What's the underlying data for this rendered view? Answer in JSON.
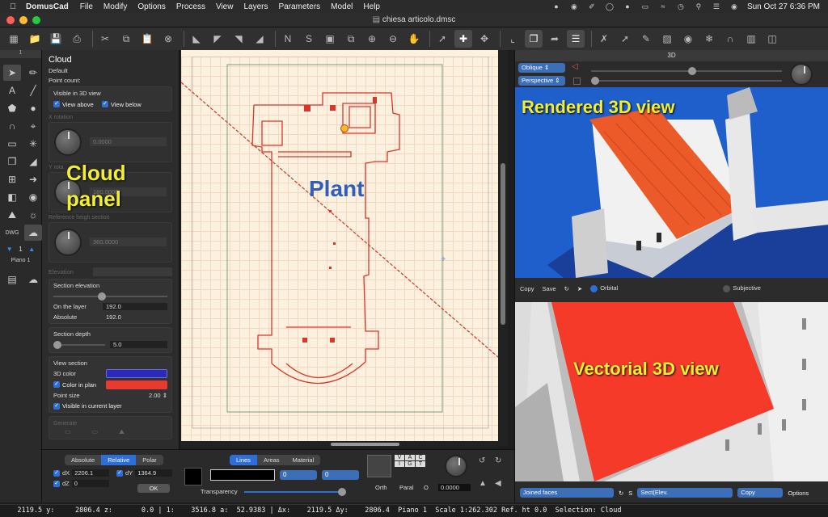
{
  "menubar": {
    "app_name": "DomusCad",
    "items": [
      "File",
      "Modify",
      "Options",
      "Process",
      "View",
      "Layers",
      "Parameters",
      "Model",
      "Help"
    ],
    "clock": "Sun Oct 27  6:36 PM"
  },
  "window": {
    "title": "chiesa articolo.dmsc"
  },
  "palette": {
    "tab": "1",
    "dwg_label": "DWG",
    "layer_number": "1",
    "layer_name": "Piano 1"
  },
  "cloud_panel": {
    "title": "Cloud",
    "subtitle": "Default",
    "point_count_label": "Point count:",
    "visible_3d_label": "Visible in 3D view",
    "view_above": "View above",
    "view_below": "View below",
    "x_rotation_label": "X rotation",
    "x_rotation_value": "0.0000",
    "y_rotation_label": "Y rota",
    "y_rotation_value": "180.0000",
    "ref_heigh_label": "Reference heigh section",
    "ref_heigh_value": "360.0000",
    "elevation_label": "Elevation",
    "section_elevation_label": "Section elevation",
    "on_layer_label": "On the layer",
    "on_layer_value": "192.0",
    "absolute_label": "Absolute",
    "absolute_value": "192.0",
    "section_depth_label": "Section  depth",
    "section_depth_value": "5.0",
    "view_section_label": "View section",
    "color_3d_label": "3D color",
    "color_in_plan_label": "Color in plan",
    "point_size_label": "Point size",
    "point_size_value": "2.00",
    "visible_current_layer": "Visible in current layer",
    "generate_label": "Generate"
  },
  "overlays": {
    "cloud_panel": "Cloud\npanel",
    "plant": "Plant",
    "rendered": "Rendered 3D view",
    "vectorial": "Vectorial 3D view"
  },
  "pane3d": {
    "header": "3D",
    "projection": "Oblique",
    "perspective": "Perspective",
    "copy": "Copy",
    "save": "Save",
    "orbital": "Orbital",
    "subjective": "Subjective",
    "faces": "Joined faces",
    "s_label": "S",
    "sect": "Sect(Elev.",
    "copy_dd": "Copy",
    "options": "Options"
  },
  "bottom": {
    "coord_modes": [
      "Absolute",
      "Relative",
      "Polar"
    ],
    "dx": "2206.1",
    "dy": "1364.9",
    "dz": "0",
    "ok": "OK",
    "style_tabs": [
      "Lines",
      "Areas",
      "Material"
    ],
    "dd1": "0",
    "dd2": "0",
    "transparency_label": "Transparency",
    "vac": [
      "V",
      "A",
      "C",
      "I",
      "G",
      "T"
    ],
    "orth": "Orth",
    "paral": "Paral",
    "o_label": "O",
    "angle_value": "0.0000"
  },
  "status": "   2119.5 y:     2806.4 z:       0.0 | 1:    3516.8 a:  52.9383 | Δx:    2119.5 Δy:    2806.4  Piano 1  Scale 1:262.302 Ref. ht 0.0  Selection: Cloud",
  "colors": {
    "accent": "#2d6fd6",
    "cloud_red": "#e4352a",
    "color_3d": "#2a2ab8",
    "color_plan": "#e83a2e",
    "overlay_text": "#f2ee33"
  }
}
